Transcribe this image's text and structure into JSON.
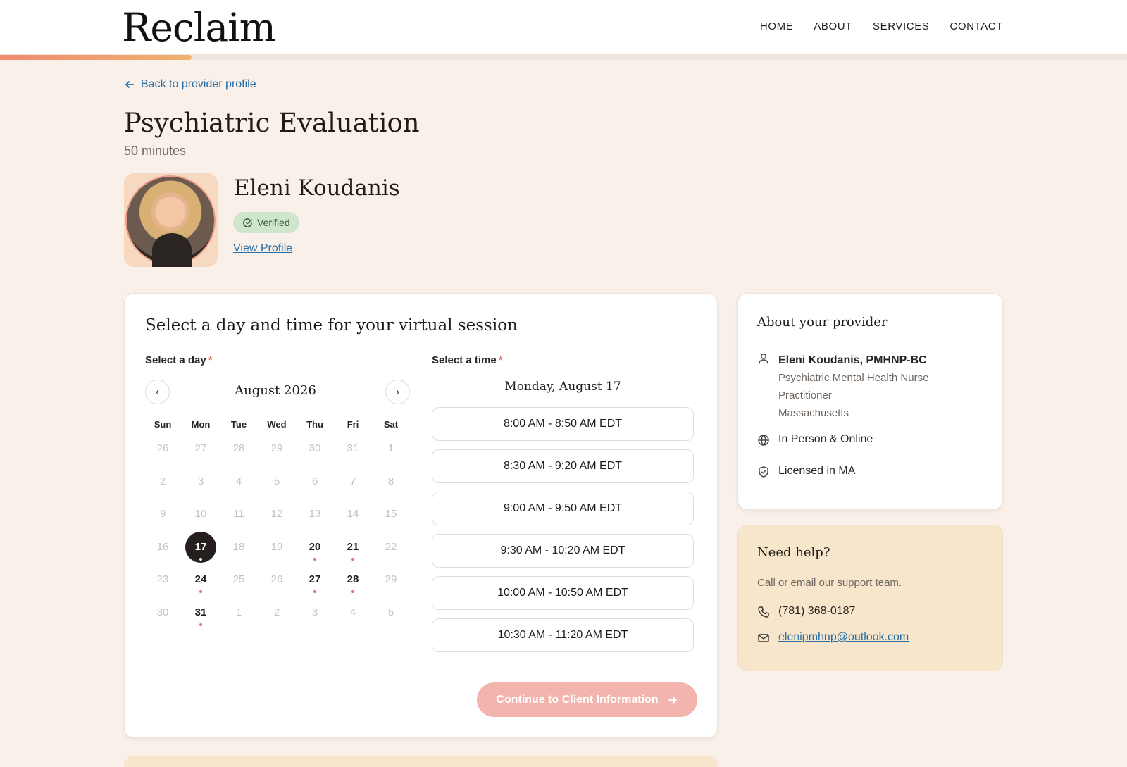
{
  "header": {
    "logo": "Reclaim",
    "nav": [
      "HOME",
      "ABOUT",
      "SERVICES",
      "CONTACT"
    ],
    "progress_fraction": 0.17
  },
  "back_link": "Back to provider profile",
  "service": {
    "title": "Psychiatric Evaluation",
    "duration": "50 minutes"
  },
  "provider": {
    "name": "Eleni Koudanis",
    "badge": "Verified",
    "view_profile": "View Profile"
  },
  "booking": {
    "title": "Select a day and time for your virtual session",
    "day_label": "Select a day",
    "time_label": "Select a time",
    "required_mark": "*",
    "month": "August 2026",
    "prev": "‹",
    "next": "›",
    "weekdays": [
      "Sun",
      "Mon",
      "Tue",
      "Wed",
      "Thu",
      "Fri",
      "Sat"
    ],
    "weeks": [
      [
        {
          "d": "26",
          "s": "muted"
        },
        {
          "d": "27",
          "s": "muted"
        },
        {
          "d": "28",
          "s": "muted"
        },
        {
          "d": "29",
          "s": "muted"
        },
        {
          "d": "30",
          "s": "muted"
        },
        {
          "d": "31",
          "s": "muted"
        },
        {
          "d": "1",
          "s": "muted"
        }
      ],
      [
        {
          "d": "2",
          "s": "muted"
        },
        {
          "d": "3",
          "s": "muted"
        },
        {
          "d": "4",
          "s": "muted"
        },
        {
          "d": "5",
          "s": "muted"
        },
        {
          "d": "6",
          "s": "muted"
        },
        {
          "d": "7",
          "s": "muted"
        },
        {
          "d": "8",
          "s": "muted"
        }
      ],
      [
        {
          "d": "9",
          "s": "muted"
        },
        {
          "d": "10",
          "s": "muted"
        },
        {
          "d": "11",
          "s": "muted"
        },
        {
          "d": "12",
          "s": "muted"
        },
        {
          "d": "13",
          "s": "muted"
        },
        {
          "d": "14",
          "s": "muted"
        },
        {
          "d": "15",
          "s": "muted"
        }
      ],
      [
        {
          "d": "16",
          "s": "muted"
        },
        {
          "d": "17",
          "s": "selected"
        },
        {
          "d": "18",
          "s": "muted"
        },
        {
          "d": "19",
          "s": "muted"
        },
        {
          "d": "20",
          "s": "avail"
        },
        {
          "d": "21",
          "s": "avail"
        },
        {
          "d": "22",
          "s": "muted"
        }
      ],
      [
        {
          "d": "23",
          "s": "muted"
        },
        {
          "d": "24",
          "s": "avail"
        },
        {
          "d": "25",
          "s": "muted"
        },
        {
          "d": "26",
          "s": "muted"
        },
        {
          "d": "27",
          "s": "avail"
        },
        {
          "d": "28",
          "s": "avail"
        },
        {
          "d": "29",
          "s": "muted"
        }
      ],
      [
        {
          "d": "30",
          "s": "muted"
        },
        {
          "d": "31",
          "s": "avail"
        },
        {
          "d": "1",
          "s": "muted"
        },
        {
          "d": "2",
          "s": "muted"
        },
        {
          "d": "3",
          "s": "muted"
        },
        {
          "d": "4",
          "s": "muted"
        },
        {
          "d": "5",
          "s": "muted"
        }
      ]
    ],
    "selected_date": "Monday, August 17",
    "slots": [
      "8:00 AM - 8:50 AM EDT",
      "8:30 AM - 9:20 AM EDT",
      "9:00 AM - 9:50 AM EDT",
      "9:30 AM - 10:20 AM EDT",
      "10:00 AM - 10:50 AM EDT",
      "10:30 AM - 11:20 AM EDT",
      ""
    ],
    "continue": "Continue to Client Information"
  },
  "about": {
    "title": "About your provider",
    "name": "Eleni Koudanis, PMHNP-BC",
    "role_line1": "Psychiatric Mental Health Nurse",
    "role_line2": "Practitioner",
    "state": "Massachusetts",
    "format": "In Person & Online",
    "license": "Licensed in MA"
  },
  "help": {
    "title": "Need help?",
    "subtitle": "Call or email our support team.",
    "phone": "(781) 368-0187",
    "email": "elenipmhnp@outlook.com"
  },
  "colors": {
    "accent": "#e0756d",
    "link": "#276ea6",
    "background": "#f8f0e9"
  }
}
